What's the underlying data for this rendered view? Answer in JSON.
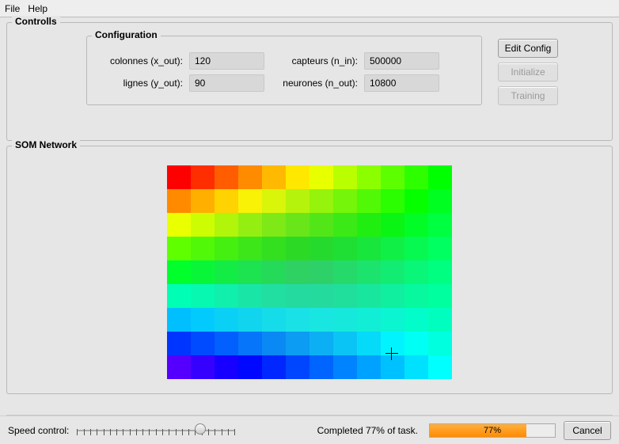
{
  "menu": {
    "file": "File",
    "help": "Help"
  },
  "controls": {
    "title": "Controlls",
    "config": {
      "title": "Configuration",
      "fields": {
        "colonnes_label": "colonnes (x_out):",
        "colonnes_value": "120",
        "lignes_label": "lignes (y_out):",
        "lignes_value": "90",
        "capteurs_label": "capteurs (n_in):",
        "capteurs_value": "500000",
        "neurones_label": "neurones (n_out):",
        "neurones_value": "10800"
      }
    },
    "buttons": {
      "edit": "Edit Config",
      "initialize": "Initialize",
      "training": "Training"
    }
  },
  "som": {
    "title": "SOM Network",
    "cursor": {
      "col_frac": 0.79,
      "row_frac": 0.88
    }
  },
  "footer": {
    "speed_label": "Speed control:",
    "slider_pos": 0.78,
    "completed_label": "Completed 77% of task.",
    "progress_pct": 77,
    "progress_text": "77%",
    "cancel": "Cancel"
  }
}
